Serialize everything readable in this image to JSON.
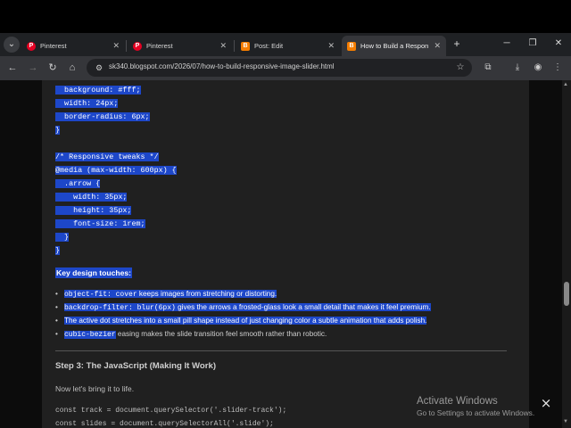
{
  "browser": {
    "tabs": [
      {
        "title": "Pinterest",
        "icon": "pinterest-icon",
        "active": false
      },
      {
        "title": "Pinterest",
        "icon": "pinterest-icon",
        "active": false
      },
      {
        "title": "Post: Edit",
        "icon": "blogger-icon",
        "active": false
      },
      {
        "title": "How to Build a Respon",
        "icon": "blogger-icon",
        "active": true
      }
    ],
    "new_tab_symbol": "+",
    "url": "sk340.blogspot.com/2026/07/how-to-build-responsive-image-slider.html"
  },
  "page": {
    "code_block": [
      {
        "text": "  background: #fff;",
        "selected": true
      },
      {
        "text": "  width: 24px;",
        "selected": true
      },
      {
        "text": "  border-radius: 6px;",
        "selected": true
      },
      {
        "text": "}",
        "selected": true
      },
      {
        "text": "",
        "selected": false
      },
      {
        "text": "/* Responsive tweaks */",
        "selected": true
      },
      {
        "text": "@media (max-width: 600px) {",
        "selected": true
      },
      {
        "text": "  .arrow {",
        "selected": true
      },
      {
        "text": "    width: 35px;",
        "selected": true
      },
      {
        "text": "    height: 35px;",
        "selected": true
      },
      {
        "text": "    font-size: 1rem;",
        "selected": true
      },
      {
        "text": "  }",
        "selected": true
      },
      {
        "text": "}",
        "selected": true
      }
    ],
    "design_heading": "Key design touches:",
    "bullets": [
      {
        "code": "object-fit: cover",
        "text": " keeps images from stretching or distorting.",
        "selected": true
      },
      {
        "code": "backdrop-filter: blur(6px)",
        "text": " gives the arrows a frosted-glass look a small detail that makes it feel premium.",
        "selected": true
      },
      {
        "code": "",
        "text": "The active dot stretches into a small pill shape instead of just changing color a subtle animation that adds polish.",
        "selected": true
      },
      {
        "code": "cubic-bezier",
        "text": " easing makes the slide transition feel smooth rather than robotic.",
        "selected": false
      }
    ],
    "step_heading": "Step 3: The JavaScript (Making It Work)",
    "step_intro": "Now let's bring it to life.",
    "js_lines": [
      "const track = document.querySelector('.slider-track');",
      "const slides = document.querySelectorAll('.slide');"
    ]
  },
  "overlay": {
    "activate_title": "Activate Windows",
    "activate_sub": "Go to Settings to activate Windows."
  }
}
